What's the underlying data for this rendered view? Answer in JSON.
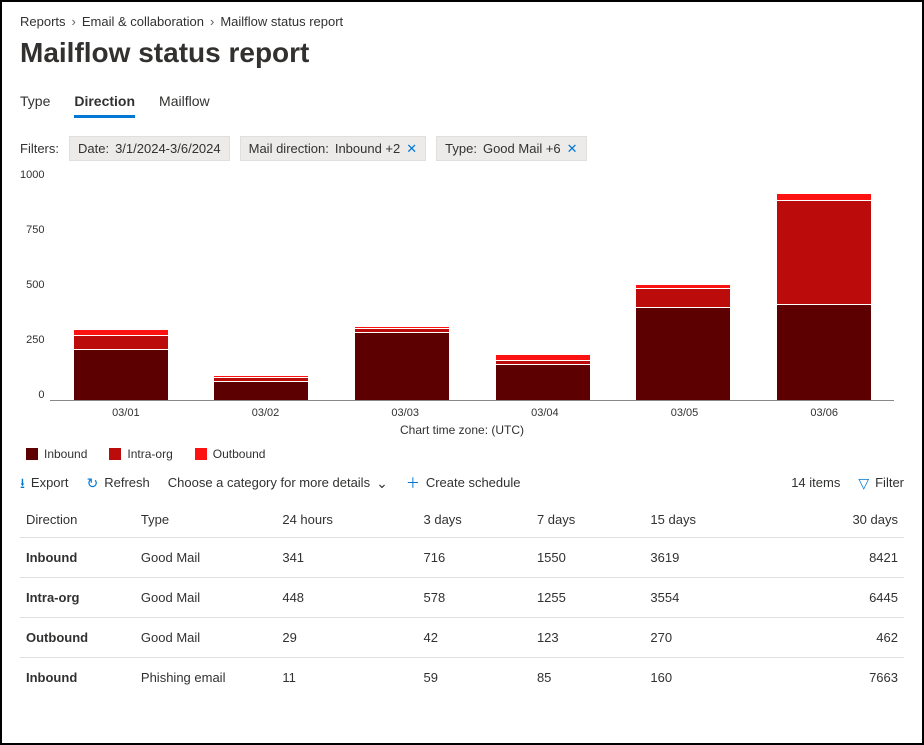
{
  "breadcrumb": {
    "a": "Reports",
    "b": "Email & collaboration",
    "c": "Mailflow status report"
  },
  "title": "Mailflow status report",
  "tabs": {
    "type": "Type",
    "direction": "Direction",
    "mailflow": "Mailflow"
  },
  "filters": {
    "label": "Filters:",
    "date": {
      "k": "Date:",
      "v": "3/1/2024-3/6/2024"
    },
    "maildir": {
      "k": "Mail direction:",
      "v": "Inbound +2"
    },
    "type": {
      "k": "Type:",
      "v": "Good Mail +6"
    }
  },
  "chart_data": {
    "type": "bar",
    "categories": [
      "03/01",
      "03/02",
      "03/03",
      "03/04",
      "03/05",
      "03/06"
    ],
    "series": [
      {
        "name": "Inbound",
        "color": "#5c0002",
        "values": [
          215,
          78,
          290,
          150,
          395,
          410
        ]
      },
      {
        "name": "Intra-org",
        "color": "#bb0b0b",
        "values": [
          55,
          12,
          10,
          12,
          80,
          445
        ]
      },
      {
        "name": "Outbound",
        "color": "#fd1212",
        "values": [
          25,
          5,
          5,
          25,
          12,
          25
        ]
      }
    ],
    "yticks": [
      0,
      250,
      500,
      750,
      1000
    ],
    "ylim": [
      0,
      1000
    ],
    "xlabel": "Chart time zone: (UTC)"
  },
  "toolbar": {
    "export": "Export",
    "refresh": "Refresh",
    "choose": "Choose a category for more details",
    "create": "Create schedule",
    "items": "14 items",
    "filter": "Filter"
  },
  "table": {
    "head": {
      "c0": "Direction",
      "c1": "Type",
      "c2": "24 hours",
      "c3": "3 days",
      "c4": "7 days",
      "c5": "15 days",
      "c6": "30 days"
    },
    "rows": [
      {
        "c0": "Inbound",
        "c1": "Good Mail",
        "c2": "341",
        "c3": "716",
        "c4": "1550",
        "c5": "3619",
        "c6": "8421"
      },
      {
        "c0": "Intra-org",
        "c1": "Good Mail",
        "c2": "448",
        "c3": "578",
        "c4": "1255",
        "c5": "3554",
        "c6": "6445"
      },
      {
        "c0": "Outbound",
        "c1": "Good Mail",
        "c2": "29",
        "c3": "42",
        "c4": "123",
        "c5": "270",
        "c6": "462"
      },
      {
        "c0": "Inbound",
        "c1": "Phishing email",
        "c2": "11",
        "c3": "59",
        "c4": "85",
        "c5": "160",
        "c6": "7663"
      }
    ]
  }
}
